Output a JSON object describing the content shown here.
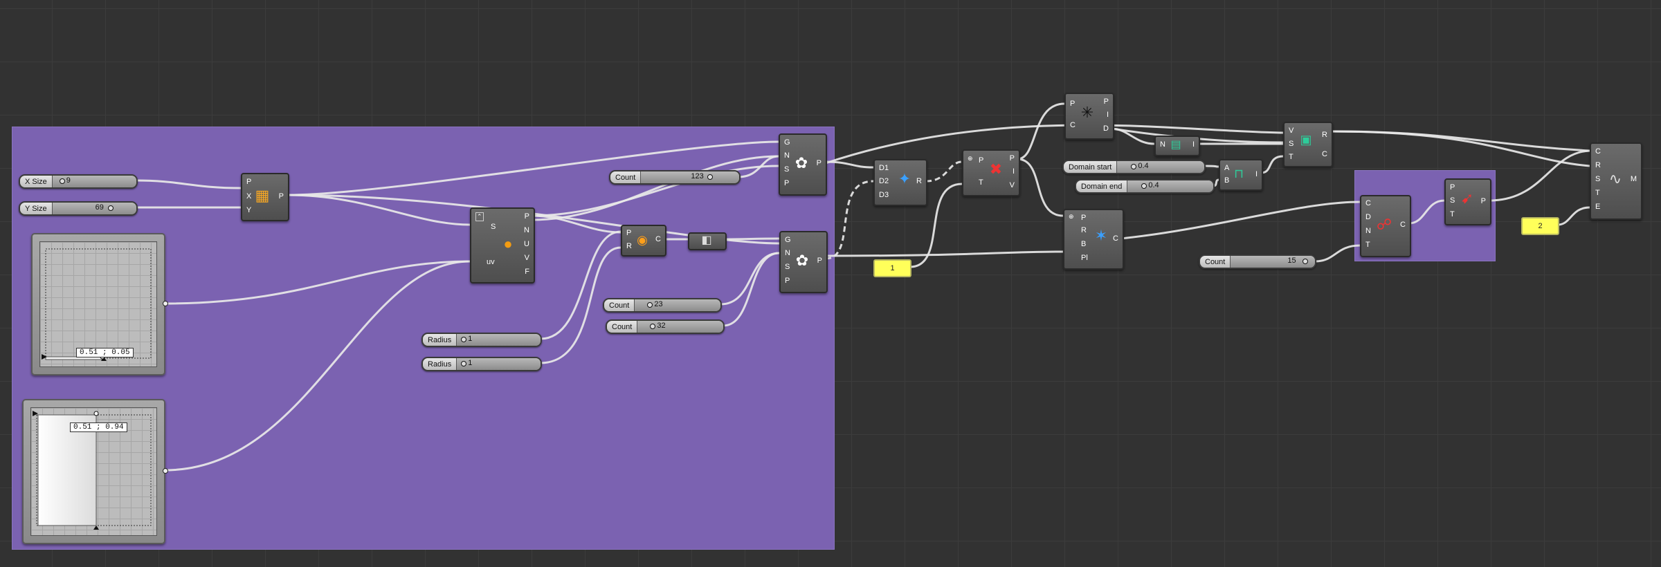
{
  "sliders": {
    "x_size": {
      "label": "X Size",
      "value": "9"
    },
    "y_size": {
      "label": "Y Size",
      "value": "69"
    },
    "count_123": {
      "label": "Count",
      "value": "123"
    },
    "count_23": {
      "label": "Count",
      "value": "23"
    },
    "count_32": {
      "label": "Count",
      "value": "32"
    },
    "radius_a": {
      "label": "Radius",
      "value": "1"
    },
    "radius_b": {
      "label": "Radius",
      "value": "1"
    },
    "domain_start": {
      "label": "Domain start",
      "value": "0.4"
    },
    "domain_end": {
      "label": "Domain end",
      "value": "0.4"
    },
    "count_15": {
      "label": "Count",
      "value": "15"
    }
  },
  "graphs": {
    "graph_a": {
      "readout": "0.51 ; 0.05"
    },
    "graph_b": {
      "readout": "0.51 ; 0.94"
    }
  },
  "panels": {
    "panel_1": "1",
    "panel_2": "2"
  },
  "components": {
    "grid": {
      "inputs": [
        "P",
        "X",
        "Y"
      ],
      "outputs": [
        "P"
      ]
    },
    "surface": {
      "inputs": [
        "S",
        "uv"
      ],
      "outputs": [
        "P",
        "N",
        "U",
        "V",
        "F"
      ]
    },
    "noise_top": {
      "inputs": [
        "G",
        "N",
        "S",
        "P"
      ],
      "outputs": [
        "P"
      ]
    },
    "noise_bottom": {
      "inputs": [
        "G",
        "N",
        "S",
        "P"
      ],
      "outputs": [
        "P"
      ]
    },
    "circle": {
      "inputs": [
        "P",
        "R"
      ],
      "outputs": [
        "C"
      ]
    },
    "merge": {
      "inputs": [
        "D1",
        "D2",
        "D3"
      ],
      "outputs": [
        "R"
      ]
    },
    "cull": {
      "inputs": [
        "P",
        "T"
      ],
      "outputs": [
        "P",
        "I",
        "V"
      ]
    },
    "closest": {
      "inputs": [
        "P",
        "C"
      ],
      "outputs": [
        "P",
        "I",
        "D"
      ]
    },
    "sort": {
      "inputs": [
        "N"
      ],
      "outputs": [
        "I"
      ]
    },
    "bounds": {
      "inputs": [
        "A",
        "B"
      ],
      "outputs": [
        "I"
      ]
    },
    "remap": {
      "inputs": [
        "V",
        "S",
        "T"
      ],
      "outputs": [
        "R",
        "C"
      ]
    },
    "plane": {
      "inputs": [
        "P",
        "R",
        "B",
        "Pl"
      ],
      "outputs": [
        "C"
      ]
    },
    "divide": {
      "inputs": [
        "C",
        "D",
        "N",
        "T"
      ],
      "outputs": [
        "C"
      ]
    },
    "evaluate": {
      "inputs": [
        "P",
        "S",
        "T"
      ],
      "outputs": [
        "P"
      ]
    },
    "sweep": {
      "inputs": [
        "C",
        "R",
        "S",
        "T",
        "E"
      ],
      "outputs": [
        "M"
      ]
    }
  },
  "colors": {
    "group": "#7b62b1",
    "canvas": "#323232",
    "panel": "#ffff5a"
  }
}
